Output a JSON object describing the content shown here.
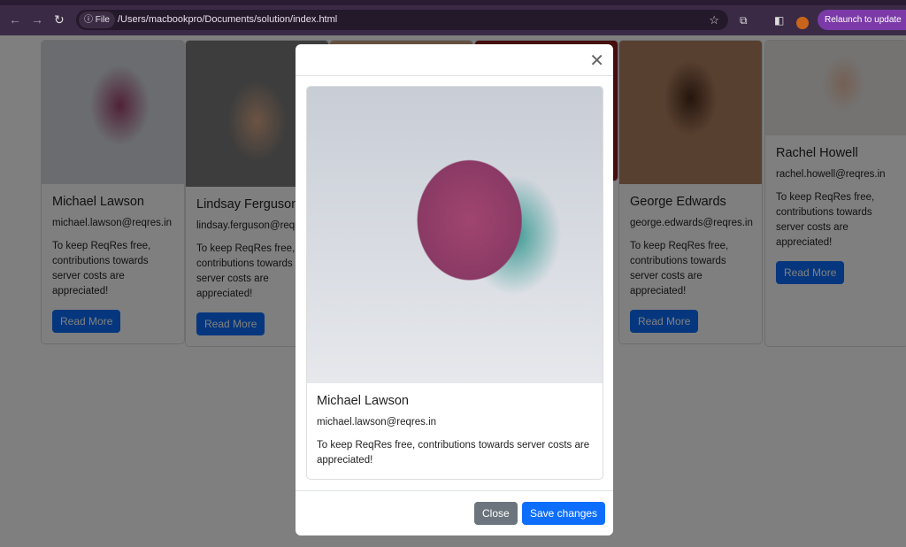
{
  "browser": {
    "chip": "File",
    "url": "/Users/macbookpro/Documents/solution/index.html",
    "relaunch": "Relaunch to update"
  },
  "cards": [
    {
      "name": "Michael Lawson",
      "email": "michael.lawson@reqres.in",
      "desc": "To keep ReqRes free, contributions towards server costs are appreciated!",
      "button": "Read More",
      "color": "#8a4a78"
    },
    {
      "name": "Lindsay Ferguson",
      "email": "lindsay.ferguson@reqres.in",
      "desc": "To keep ReqRes free, contributions towards server costs are appreciated!",
      "button": "Read More",
      "color": "#6e5a50"
    },
    {
      "name": "George Edwards",
      "email": "george.edwards@reqres.in",
      "desc": "To keep ReqRes free, contributions towards server costs are appreciated!",
      "button": "Read More",
      "color": "#7a5a3a"
    },
    {
      "name": "Rachel Howell",
      "email": "rachel.howell@reqres.in",
      "desc": "To keep ReqRes free, contributions towards server costs are appreciated!",
      "button": "Read More",
      "color": "#d8d0c8"
    }
  ],
  "modal": {
    "name": "Michael Lawson",
    "email": "michael.lawson@reqres.in",
    "desc": "To keep ReqRes free, contributions towards server costs are appreciated!",
    "close": "Close",
    "save": "Save changes"
  }
}
